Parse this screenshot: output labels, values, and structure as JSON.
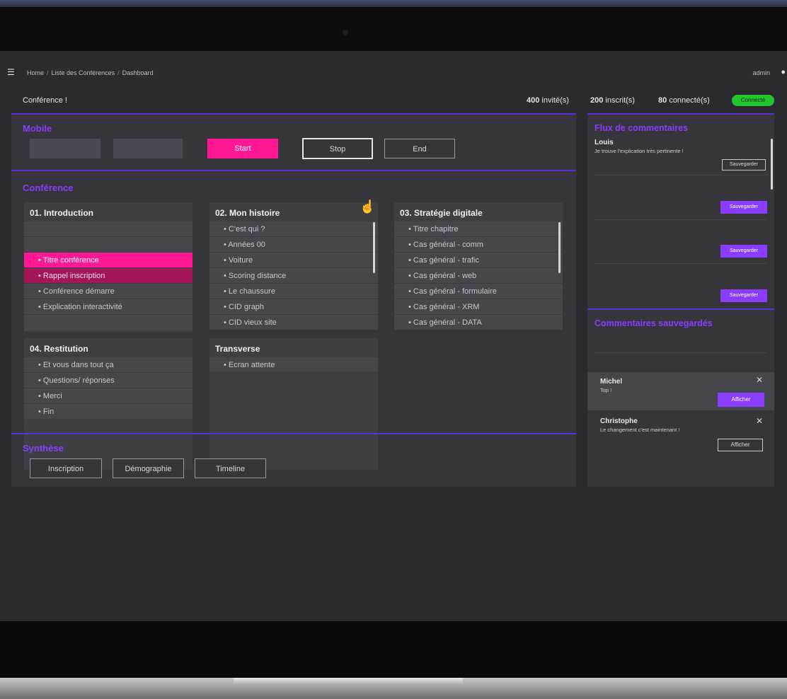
{
  "topbar": {
    "menu_icon": "hamburger-icon",
    "breadcrumb": [
      "Home",
      "Liste des Conférences",
      "Dashboard"
    ],
    "user": "admin",
    "user_icon": "user-icon"
  },
  "status": {
    "conference_title": "Conférence !",
    "invites_count": "400",
    "invites_label": "invité(s)",
    "inscrits_count": "200",
    "inscrits_label": "inscrit(s)",
    "connectes_count": "80",
    "connectes_label": "connecté(s)",
    "badge": "Connecté"
  },
  "mobile": {
    "title": "Mobile",
    "buttons": [
      "Start",
      "Stop",
      "End"
    ]
  },
  "conference": {
    "title": "Conférence",
    "chapters": [
      {
        "title": "01. Introduction",
        "items": [
          "• Titre conférence",
          "• Rappel inscription",
          "• Conférence démarre",
          "• Explication interactivité"
        ]
      },
      {
        "title": "02. Mon histoire",
        "items": [
          "• C'est qui ?",
          "• Années 00",
          "• Voiture",
          "• Scoring distance",
          "• Le chaussure",
          "• CID graph",
          "• CID vieux site"
        ]
      },
      {
        "title": "03. Stratégie digitale",
        "items": [
          "• Titre chapitre",
          "• Cas général - comm",
          "• Cas général - trafic",
          "• Cas général - web",
          "• Cas général - formulaire",
          "• Cas général - XRM",
          "• Cas général - DATA"
        ]
      },
      {
        "title": "04. Restitution",
        "items": [
          "• Et vous dans tout ça",
          "• Questions/ réponses",
          "• Merci",
          "• Fin"
        ]
      },
      {
        "title": "Transverse",
        "items": [
          "• Ecran attente"
        ]
      }
    ]
  },
  "synthese": {
    "title": "Synthèse",
    "buttons": [
      "Inscription",
      "Démographie",
      "Timeline"
    ]
  },
  "feed": {
    "title": "Flux de commentaires",
    "items": [
      {
        "name": "Louis",
        "text": "Je trouve l'explication très pertinente !",
        "action": "Sauvegarder"
      }
    ],
    "save_label": "Sauvegarder"
  },
  "saved": {
    "title": "Commentaires sauvegardés",
    "items": [
      {
        "name": "Michel",
        "text": "Top !",
        "action": "Afficher"
      },
      {
        "name": "Christophe",
        "text": "Le changement c'est maintenant !",
        "action": "Afficher"
      }
    ]
  },
  "colors": {
    "accent_purple": "#8a3dff",
    "accent_pink": "#ff1793",
    "live_green": "#22c52d"
  }
}
